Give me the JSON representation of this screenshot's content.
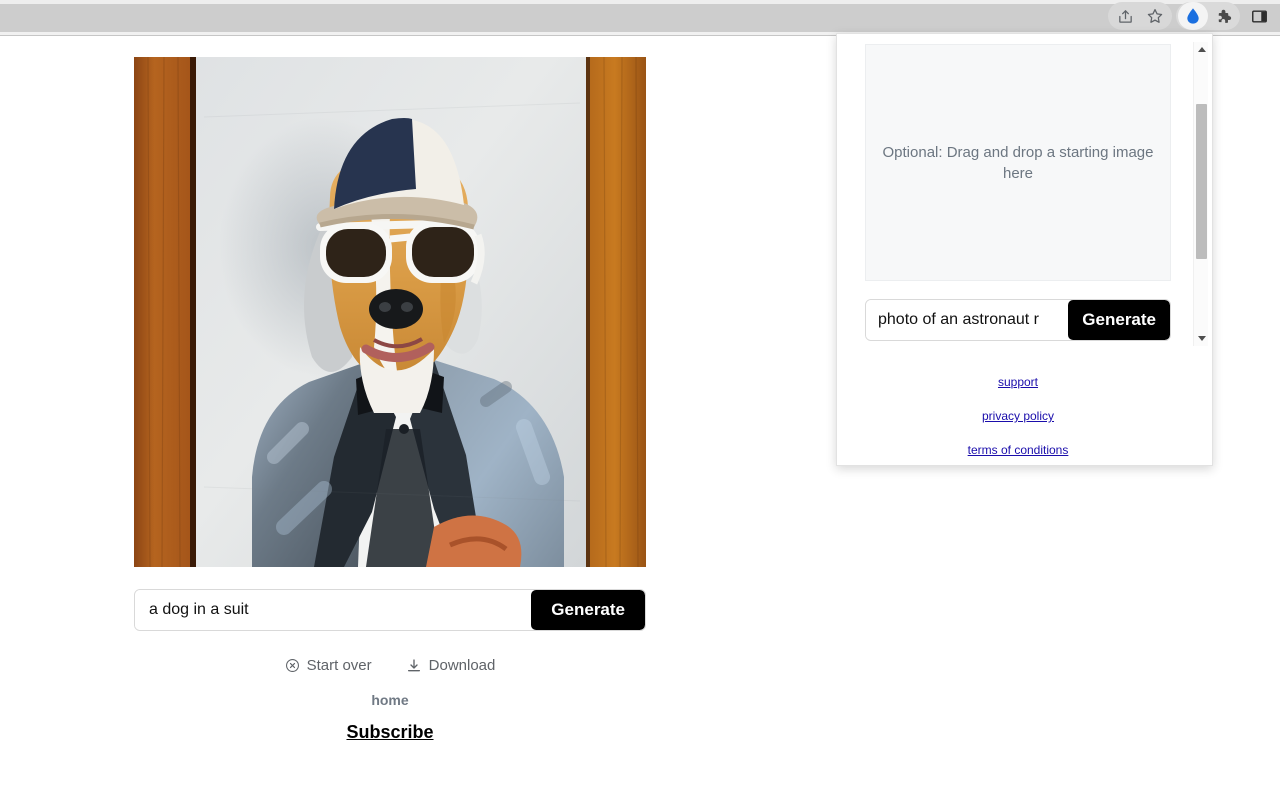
{
  "browser": {
    "toolbar_icons": [
      {
        "name": "share-icon",
        "glyph": "share"
      },
      {
        "name": "bookmark-star-icon",
        "glyph": "star"
      },
      {
        "name": "extension-waterdrop-icon",
        "glyph": "droplet",
        "color": "#1a73e8"
      },
      {
        "name": "extensions-puzzle-icon",
        "glyph": "puzzle"
      },
      {
        "name": "side-panel-icon",
        "glyph": "panel"
      }
    ]
  },
  "main": {
    "artwork": {
      "alt": "a dog in a suit",
      "description": "Oil painting of a dog wearing sunglasses, a navy and white cap and a grey-blue tuxedo with black bow tie, canvas propped against a wooden wall"
    },
    "prompt": {
      "value": "a dog in a suit",
      "placeholder": "a dog in a suit"
    },
    "generate_label": "Generate",
    "actions": [
      {
        "label": "Start over",
        "icon": "circle-x-icon"
      },
      {
        "label": "Download",
        "icon": "download-icon"
      }
    ],
    "home_label": "home",
    "subscribe_label": "Subscribe"
  },
  "popup": {
    "dropzone_text": "Optional: Drag and drop a starting image here",
    "prompt": {
      "value": "photo of an astronaut r",
      "placeholder": "photo of an astronaut r"
    },
    "generate_label": "Generate",
    "links": [
      {
        "label": "support"
      },
      {
        "label": "privacy policy"
      },
      {
        "label": "terms of conditions"
      }
    ],
    "link_color": "#1a0dab"
  }
}
